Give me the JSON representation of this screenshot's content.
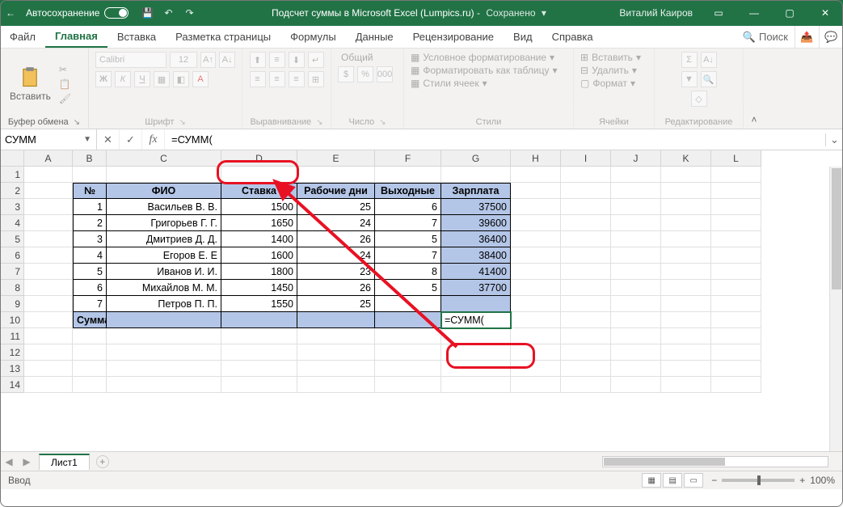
{
  "titlebar": {
    "autosave": "Автосохранение",
    "filename": "Подсчет суммы в Microsoft Excel (Lumpics.ru)",
    "saved_state": "Сохранено",
    "user": "Виталий Каиров"
  },
  "tabs": {
    "file": "Файл",
    "home": "Главная",
    "insert": "Вставка",
    "layout": "Разметка страницы",
    "formulas": "Формулы",
    "data": "Данные",
    "review": "Рецензирование",
    "view": "Вид",
    "help": "Справка",
    "search": "Поиск"
  },
  "ribbon": {
    "paste": "Вставить",
    "clipboard": "Буфер обмена",
    "font_name": "Calibri",
    "font_size": "12",
    "font": "Шрифт",
    "alignment": "Выравнивание",
    "num_format": "Общий",
    "number": "Число",
    "cond_format": "Условное форматирование",
    "as_table": "Форматировать как таблицу",
    "cell_styles": "Стили ячеек",
    "styles": "Стили",
    "insert_cells": "Вставить",
    "delete_cells": "Удалить",
    "format_cells": "Формат",
    "cells": "Ячейки",
    "editing": "Редактирование"
  },
  "formula_bar": {
    "name_box": "СУММ",
    "formula": "=СУММ("
  },
  "columns": [
    "A",
    "B",
    "C",
    "D",
    "E",
    "F",
    "G",
    "H",
    "I",
    "J",
    "K",
    "L"
  ],
  "table": {
    "headers": {
      "b": "№",
      "c": "ФИО",
      "d": "Ставка",
      "e": "Рабочие дни",
      "f": "Выходные",
      "g": "Зарплата"
    },
    "rows": [
      {
        "n": "1",
        "fio": "Васильев В. В.",
        "rate": "1500",
        "days": "25",
        "off": "6",
        "sal": "37500"
      },
      {
        "n": "2",
        "fio": "Григорьев Г. Г.",
        "rate": "1650",
        "days": "24",
        "off": "7",
        "sal": "39600"
      },
      {
        "n": "3",
        "fio": "Дмитриев Д. Д.",
        "rate": "1400",
        "days": "26",
        "off": "5",
        "sal": "36400"
      },
      {
        "n": "4",
        "fio": "Егоров Е. Е",
        "rate": "1600",
        "days": "24",
        "off": "7",
        "sal": "38400"
      },
      {
        "n": "5",
        "fio": "Иванов И. И.",
        "rate": "1800",
        "days": "23",
        "off": "8",
        "sal": "41400"
      },
      {
        "n": "6",
        "fio": "Михайлов М. М.",
        "rate": "1450",
        "days": "26",
        "off": "5",
        "sal": "37700"
      },
      {
        "n": "7",
        "fio": "Петров П. П.",
        "rate": "1550",
        "days": "25",
        "off": "",
        "sal": ""
      }
    ],
    "sum_row_label": "Сумма",
    "sum_row_formula": "=СУММ("
  },
  "sheet": {
    "name": "Лист1"
  },
  "status": {
    "mode": "Ввод",
    "zoom": "100%"
  }
}
